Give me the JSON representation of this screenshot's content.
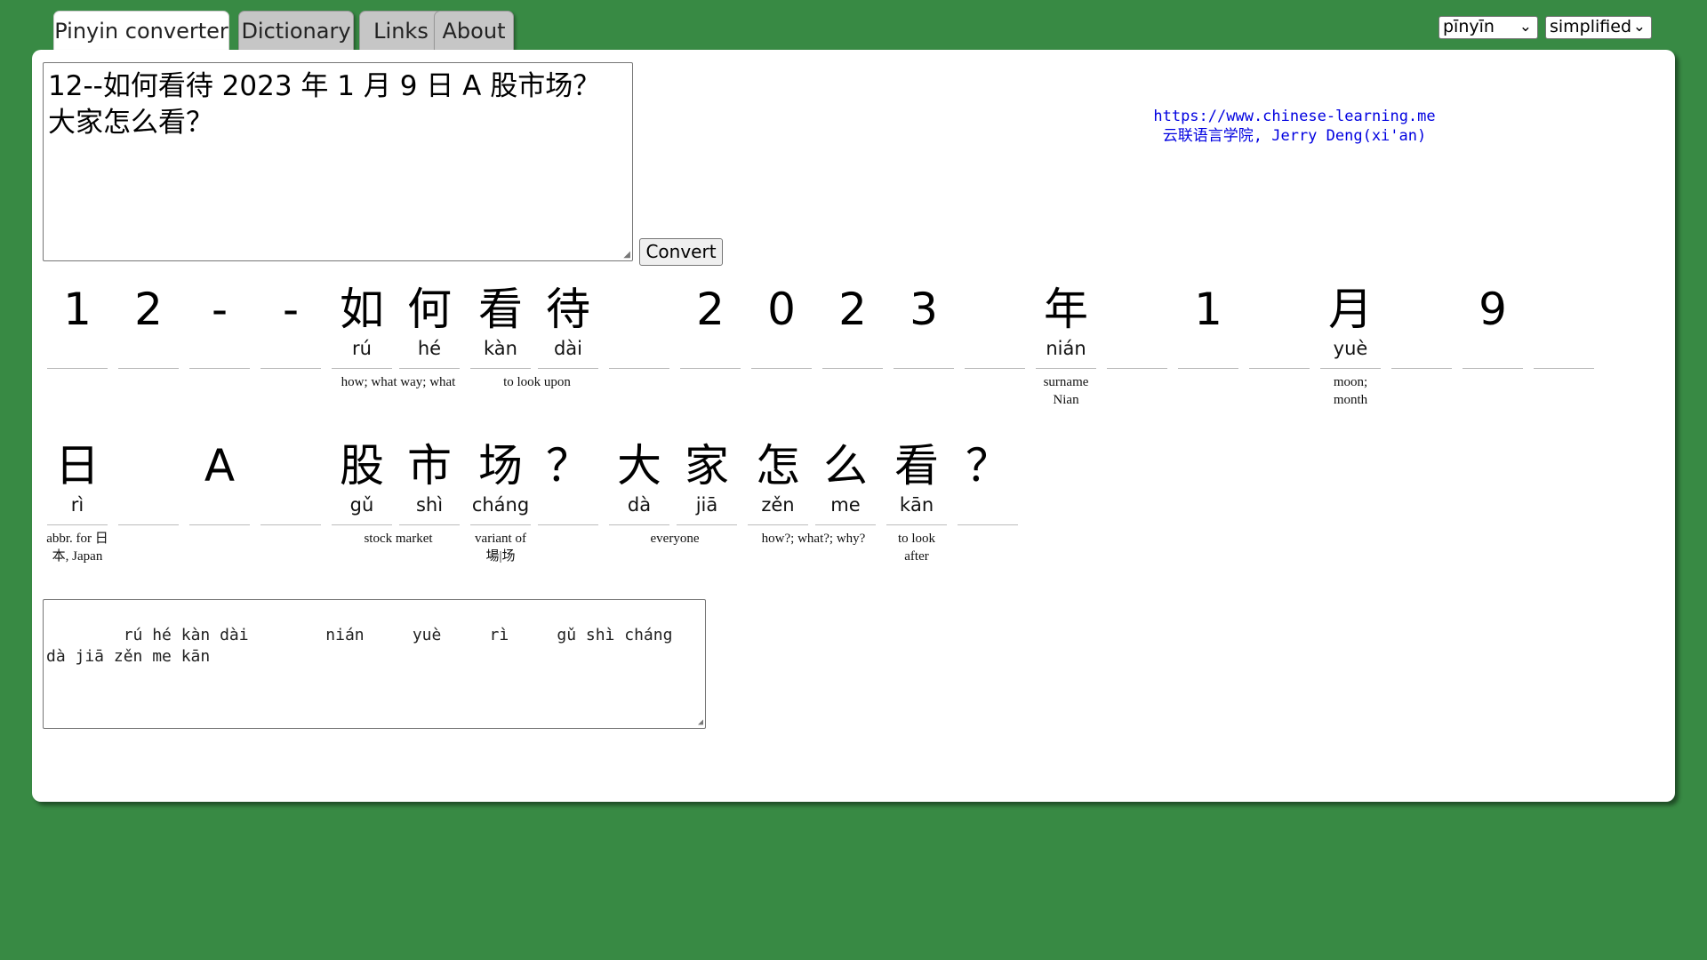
{
  "tabs": [
    {
      "label": "Pinyin converter",
      "active": true
    },
    {
      "label": "Dictionary",
      "active": false
    },
    {
      "label": "Links",
      "active": false
    },
    {
      "label": "About",
      "active": false
    }
  ],
  "selects": {
    "romanization": "pīnyīn",
    "script": "simplified"
  },
  "input": {
    "value": "12--如何看待 2023 年 1 月 9 日 A 股市场？大家怎么看？"
  },
  "convert_button": {
    "label": "Convert"
  },
  "credit": {
    "url": "https://www.chinese-learning.me",
    "author": "云联语言学院, Jerry Deng(xi'an)"
  },
  "row1": {
    "chars": [
      {
        "hz": "1",
        "py": ""
      },
      {
        "hz": "2",
        "py": ""
      },
      {
        "hz": "-",
        "py": ""
      },
      {
        "hz": "-",
        "py": ""
      },
      {
        "hz": "如",
        "py": "rú"
      },
      {
        "hz": "何",
        "py": "hé"
      },
      {
        "hz": "看",
        "py": "kàn"
      },
      {
        "hz": "待",
        "py": "dài"
      },
      {
        "hz": "",
        "py": ""
      },
      {
        "hz": "2",
        "py": ""
      },
      {
        "hz": "0",
        "py": ""
      },
      {
        "hz": "2",
        "py": ""
      },
      {
        "hz": "3",
        "py": ""
      },
      {
        "hz": "",
        "py": ""
      },
      {
        "hz": "年",
        "py": "nián"
      },
      {
        "hz": "",
        "py": ""
      },
      {
        "hz": "1",
        "py": ""
      },
      {
        "hz": "",
        "py": ""
      },
      {
        "hz": "月",
        "py": "yuè"
      },
      {
        "hz": "",
        "py": ""
      },
      {
        "hz": "9",
        "py": ""
      },
      {
        "hz": "",
        "py": ""
      }
    ],
    "glosses": [
      {
        "text": "how; what way; what"
      },
      {
        "text": "to look upon"
      },
      {
        "text": "surname Nian"
      },
      {
        "text": "moon; month"
      }
    ]
  },
  "row2": {
    "chars": [
      {
        "hz": "日",
        "py": "rì"
      },
      {
        "hz": "",
        "py": ""
      },
      {
        "hz": "A",
        "py": ""
      },
      {
        "hz": "",
        "py": ""
      },
      {
        "hz": "股",
        "py": "gǔ"
      },
      {
        "hz": "市",
        "py": "shì"
      },
      {
        "hz": "场",
        "py": "cháng"
      },
      {
        "hz": "？",
        "py": ""
      },
      {
        "hz": "大",
        "py": "dà"
      },
      {
        "hz": "家",
        "py": "jiā"
      },
      {
        "hz": "怎",
        "py": "zěn"
      },
      {
        "hz": "么",
        "py": "me"
      },
      {
        "hz": "看",
        "py": "kān"
      },
      {
        "hz": "？",
        "py": ""
      }
    ],
    "glosses": [
      {
        "text": "abbr. for 日本, Japan"
      },
      {
        "text": "stock market"
      },
      {
        "text": "variant of 場|场"
      },
      {
        "text": "everyone"
      },
      {
        "text": "how?; what?; why?"
      },
      {
        "text": "to look after"
      }
    ]
  },
  "output": {
    "value": "    rú hé kàn dài        nián     yuè     rì     gǔ shì cháng  dà jiā zěn me kān"
  }
}
